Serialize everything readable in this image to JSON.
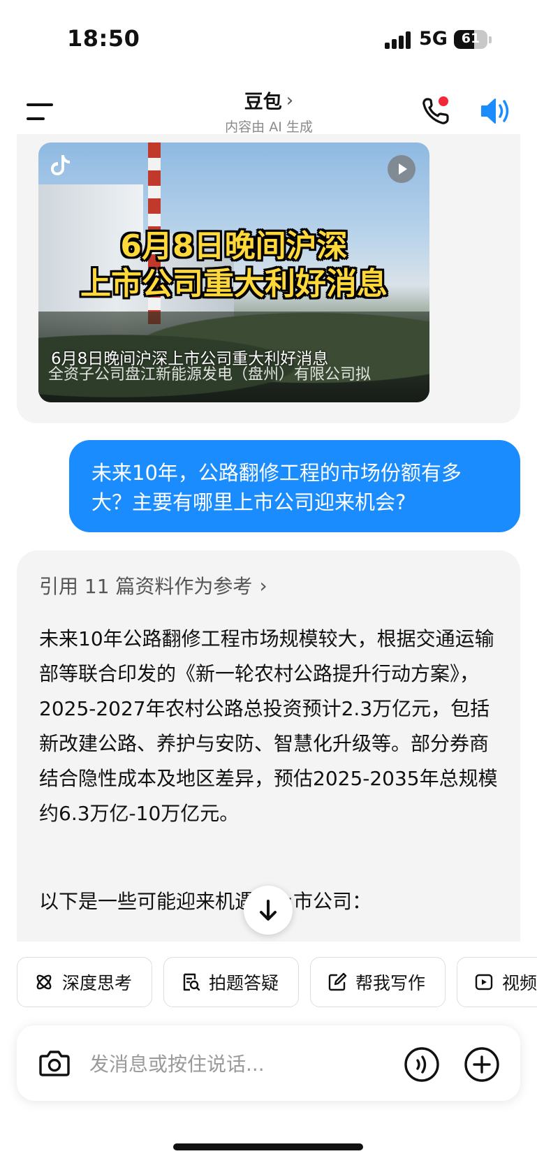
{
  "status_bar": {
    "time": "18:50",
    "network": "5G",
    "battery": "61",
    "battery_level": 0.61
  },
  "header": {
    "title": "豆包",
    "title_chevron": "›",
    "subtitle": "内容由 AI 生成",
    "icons": [
      "menu-icon",
      "phone-icon",
      "speaker-icon"
    ],
    "call_dot_color": "#f2283a",
    "accent_color": "#1a8cfd"
  },
  "video_card": {
    "headline_line1": "6月8日晚间沪深",
    "headline_line2": "上市公司重大利好消息",
    "caption": "6月8日晚间沪深上市公司重大利好消息",
    "subcaption": "全资子公司盘江新能源发电（盘州）有限公司拟",
    "icons": [
      "tiktok-icon",
      "play-icon"
    ]
  },
  "user_message": {
    "text": "未来10年，公路翻修工程的市场份额有多大？主要有哪里上市公司迎来机会?"
  },
  "ai_answer": {
    "reference": "引用 11 篇资料作为参考",
    "reference_chevron": "›",
    "paragraph": "未来10年公路翻修工程市场规模较大，根据交通运输部等联合印发的《新一轮农村公路提升行动方案》，2025-2027年农村公路总投资预计2.3万亿元，包括新改建公路、养护与安防、智慧化升级等。部分券商结合隐性成本及地区差异，预估2025-2035年总规模约6.3万亿-10万亿元。",
    "paragraph2": "以下是一些可能迎来机遇的上市公司："
  },
  "chips": [
    {
      "label": "深度思考",
      "icon": "atom-icon"
    },
    {
      "label": "拍题答疑",
      "icon": "photo-question-icon"
    },
    {
      "label": "帮我写作",
      "icon": "edit-icon"
    },
    {
      "label": "视频",
      "icon": "video-icon"
    }
  ],
  "input": {
    "placeholder": "发消息或按住说话..."
  }
}
